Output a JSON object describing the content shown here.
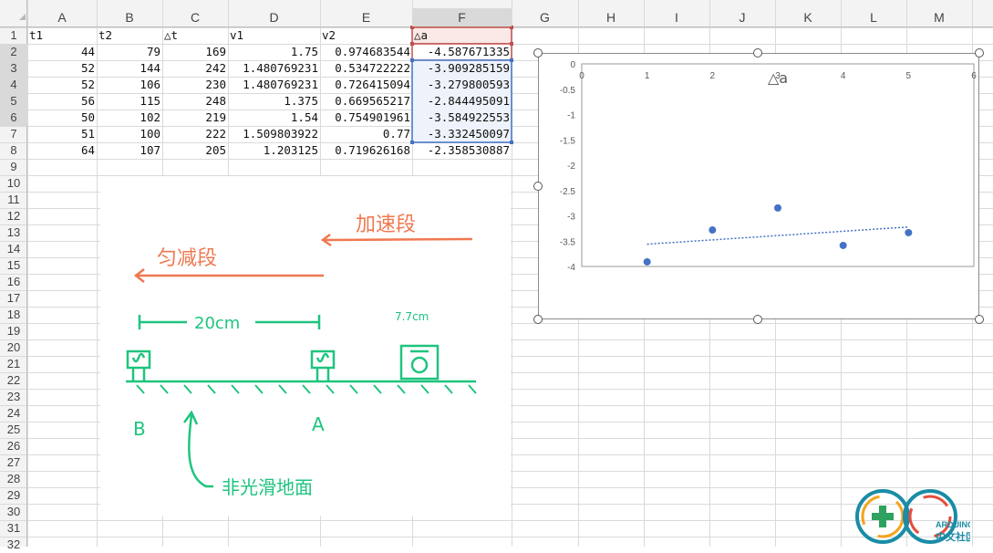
{
  "sheet": {
    "columns": [
      "A",
      "B",
      "C",
      "D",
      "E",
      "F",
      "G",
      "H",
      "I",
      "J",
      "K",
      "L",
      "M"
    ],
    "rows": [
      "1",
      "2",
      "3",
      "4",
      "5",
      "6",
      "7",
      "8",
      "9",
      "10",
      "11",
      "12",
      "13",
      "14",
      "15",
      "16",
      "17",
      "18",
      "19",
      "20",
      "21",
      "22",
      "23",
      "24",
      "25",
      "26",
      "27",
      "28",
      "29",
      "30",
      "31",
      "32"
    ],
    "header_row": [
      "t1",
      "t2",
      "△t",
      "v1",
      "v2",
      "△a"
    ],
    "data": [
      [
        "44",
        "79",
        "169",
        "1.75",
        "0.974683544",
        "-4.587671335"
      ],
      [
        "52",
        "144",
        "242",
        "1.480769231",
        "0.534722222",
        "-3.909285159"
      ],
      [
        "52",
        "106",
        "230",
        "1.480769231",
        "0.726415094",
        "-3.279800593"
      ],
      [
        "56",
        "115",
        "248",
        "1.375",
        "0.669565217",
        "-2.844495091"
      ],
      [
        "50",
        "102",
        "219",
        "1.54",
        "0.754901961",
        "-3.584922553"
      ],
      [
        "51",
        "100",
        "222",
        "1.509803922",
        "0.77",
        "-3.332450097"
      ],
      [
        "64",
        "107",
        "205",
        "1.203125",
        "0.719626168",
        "-2.358530887"
      ]
    ]
  },
  "sketch": {
    "accel_label": "加速段",
    "decel_label": "匀减段",
    "distance_label": "20cm",
    "car_label": "7.7cm",
    "gate_b": "B",
    "gate_a": "A",
    "surface_label": "非光滑地面"
  },
  "chart_data": {
    "type": "scatter",
    "title": "△a",
    "x": [
      1,
      2,
      3,
      4,
      5
    ],
    "y": [
      -3.909285159,
      -3.279800593,
      -2.844495091,
      -3.584922553,
      -3.332450097
    ],
    "xlim": [
      0,
      6
    ],
    "ylim": [
      -4,
      0
    ],
    "xticks": [
      "0",
      "1",
      "2",
      "3",
      "4",
      "5",
      "6"
    ],
    "yticks": [
      "0",
      "-0.5",
      "-1",
      "-1.5",
      "-2",
      "-2.5",
      "-3",
      "-3.5",
      "-4"
    ],
    "trendline": "linear",
    "grid": false,
    "legend": "none",
    "colors": {
      "point": "#4472C4",
      "trend": "#4472C4"
    }
  },
  "logo": {
    "text1": "ARDUINO",
    "text2": "中文社区"
  }
}
